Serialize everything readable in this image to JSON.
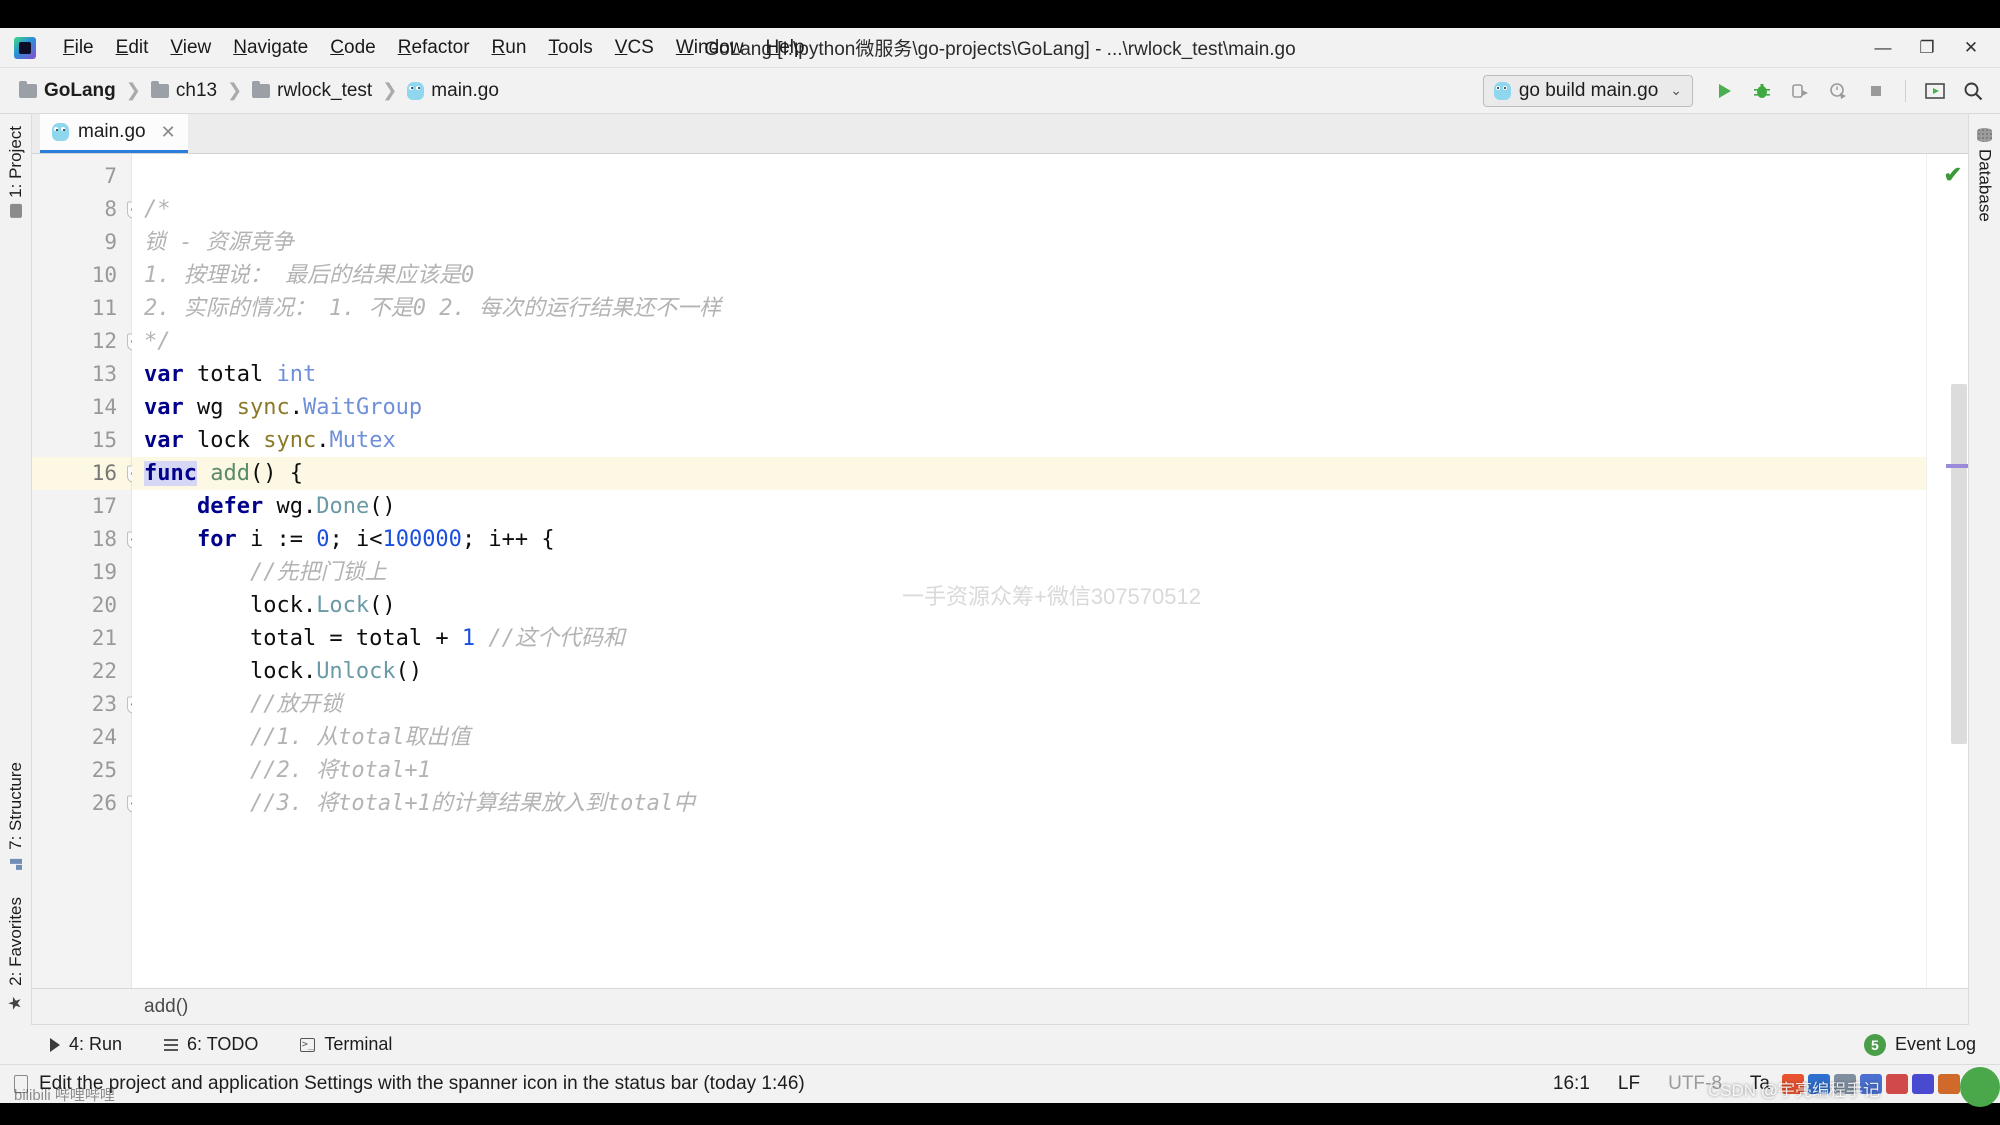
{
  "window": {
    "title": "GoLang [I:\\python微服务\\go-projects\\GoLang] - ...\\rwlock_test\\main.go",
    "minimize": "—",
    "maximize": "❐",
    "close": "✕"
  },
  "menubar": {
    "items": [
      "File",
      "Edit",
      "View",
      "Navigate",
      "Code",
      "Refactor",
      "Run",
      "Tools",
      "VCS",
      "Window",
      "Help"
    ]
  },
  "breadcrumb": {
    "items": [
      "GoLang",
      "ch13",
      "rwlock_test",
      "main.go"
    ],
    "separator": "❯"
  },
  "toolbar": {
    "run_config": "go build main.go",
    "chevron": "⌄",
    "icons": [
      "run-icon",
      "debug-icon",
      "run-coverage-icon",
      "profile-icon",
      "stop-icon",
      "updates-icon",
      "search-everywhere-icon"
    ]
  },
  "editor_tabs": [
    {
      "label": "main.go",
      "close": "✕",
      "active": true
    }
  ],
  "left_strip": [
    {
      "label": "1: Project",
      "icon": "folder-icon"
    },
    {
      "label": "7: Structure",
      "icon": "structure-icon"
    },
    {
      "label": "2: Favorites",
      "icon": "star-icon"
    }
  ],
  "right_strip": [
    {
      "label": "Database",
      "icon": "database-icon"
    }
  ],
  "editor": {
    "first_line": 7,
    "current_line": 16,
    "watermark": "一手资源众筹+微信307570512",
    "status_check": "✔",
    "lines": [
      {
        "n": 7,
        "tokens": []
      },
      {
        "n": 8,
        "fold": true,
        "tokens": [
          {
            "t": "/*",
            "c": "cmt"
          }
        ]
      },
      {
        "n": 9,
        "tokens": [
          {
            "t": "锁 - 资源竞争",
            "c": "cmt"
          }
        ]
      },
      {
        "n": 10,
        "tokens": [
          {
            "t": "1. 按理说： 最后的结果应该是0",
            "c": "cmt"
          }
        ]
      },
      {
        "n": 11,
        "tokens": [
          {
            "t": "2. 实际的情况： 1. 不是0 2. 每次的运行结果还不一样",
            "c": "cmt"
          }
        ]
      },
      {
        "n": 12,
        "fold": true,
        "tokens": [
          {
            "t": "*/",
            "c": "cmt"
          }
        ]
      },
      {
        "n": 13,
        "tokens": [
          {
            "t": "var",
            "c": "kw"
          },
          {
            "t": " total ",
            "c": ""
          },
          {
            "t": "int",
            "c": "typ"
          }
        ]
      },
      {
        "n": 14,
        "tokens": [
          {
            "t": "var",
            "c": "kw"
          },
          {
            "t": " wg ",
            "c": ""
          },
          {
            "t": "sync",
            "c": "pkg"
          },
          {
            "t": ".",
            "c": ""
          },
          {
            "t": "WaitGroup",
            "c": "typ"
          }
        ]
      },
      {
        "n": 15,
        "tokens": [
          {
            "t": "var",
            "c": "kw"
          },
          {
            "t": " lock ",
            "c": ""
          },
          {
            "t": "sync",
            "c": "pkg"
          },
          {
            "t": ".",
            "c": ""
          },
          {
            "t": "Mutex",
            "c": "typ"
          }
        ]
      },
      {
        "n": 16,
        "cur": true,
        "fold": true,
        "tokens": [
          {
            "t": "func",
            "c": "kw-hl"
          },
          {
            "t": " ",
            "c": ""
          },
          {
            "t": "add",
            "c": "fn"
          },
          {
            "t": "() {",
            "c": ""
          }
        ]
      },
      {
        "n": 17,
        "tokens": [
          {
            "t": "    ",
            "c": ""
          },
          {
            "t": "defer",
            "c": "kw"
          },
          {
            "t": " wg.",
            "c": ""
          },
          {
            "t": "Done",
            "c": "mth"
          },
          {
            "t": "()",
            "c": ""
          }
        ]
      },
      {
        "n": 18,
        "fold": true,
        "tokens": [
          {
            "t": "    ",
            "c": ""
          },
          {
            "t": "for",
            "c": "kw"
          },
          {
            "t": " i := ",
            "c": ""
          },
          {
            "t": "0",
            "c": "num"
          },
          {
            "t": "; i<",
            "c": ""
          },
          {
            "t": "100000",
            "c": "num"
          },
          {
            "t": "; i++ {",
            "c": ""
          }
        ]
      },
      {
        "n": 19,
        "tokens": [
          {
            "t": "        //先把门锁上",
            "c": "cmt"
          }
        ]
      },
      {
        "n": 20,
        "tokens": [
          {
            "t": "        lock.",
            "c": ""
          },
          {
            "t": "Lock",
            "c": "mth"
          },
          {
            "t": "()",
            "c": ""
          }
        ]
      },
      {
        "n": 21,
        "tokens": [
          {
            "t": "        total = total + ",
            "c": ""
          },
          {
            "t": "1",
            "c": "num"
          },
          {
            "t": " //这个代码和",
            "c": "cmt"
          }
        ]
      },
      {
        "n": 22,
        "tokens": [
          {
            "t": "        lock.",
            "c": ""
          },
          {
            "t": "Unlock",
            "c": "mth"
          },
          {
            "t": "()",
            "c": ""
          }
        ]
      },
      {
        "n": 23,
        "fold": true,
        "tokens": [
          {
            "t": "        //放开锁",
            "c": "cmt"
          }
        ]
      },
      {
        "n": 24,
        "tokens": [
          {
            "t": "        //1. 从total取出值",
            "c": "cmt"
          }
        ]
      },
      {
        "n": 25,
        "tokens": [
          {
            "t": "        //2. 将total+1",
            "c": "cmt"
          }
        ]
      },
      {
        "n": 26,
        "fold": true,
        "tokens": [
          {
            "t": "        //3. 将total+1的计算结果放入到total中",
            "c": "cmt"
          }
        ]
      }
    ]
  },
  "bottom_breadcrumb": "add()",
  "tool_windows": [
    {
      "label": "4: Run",
      "icon": "run-triangle-icon"
    },
    {
      "label": "6: TODO",
      "icon": "todo-list-icon"
    },
    {
      "label": "Terminal",
      "icon": "terminal-icon"
    }
  ],
  "event_log": {
    "label": "Event Log",
    "count": "5"
  },
  "status_bar": {
    "message": "Edit the project and application Settings with the spanner icon in the status bar (today 1:46)",
    "caret": "16:1",
    "line_separator": "LF",
    "encoding": "UTF-8",
    "indent": "Ta",
    "csdn_watermark": "CSDN @宇亮编程手记",
    "bilibili_watermark": "bilibili 哔哩哔哩"
  },
  "colors": {
    "accent": "#2b7ddb",
    "keyword": "#00008b",
    "number": "#1a4fe0",
    "comment": "#b3b3b3",
    "package": "#8a7a28",
    "type": "#6f8fd8",
    "method": "#6a9aa6",
    "function": "#5a8a6a",
    "current_line": "#fdf8e3",
    "ok_green": "#3a9a3a"
  }
}
